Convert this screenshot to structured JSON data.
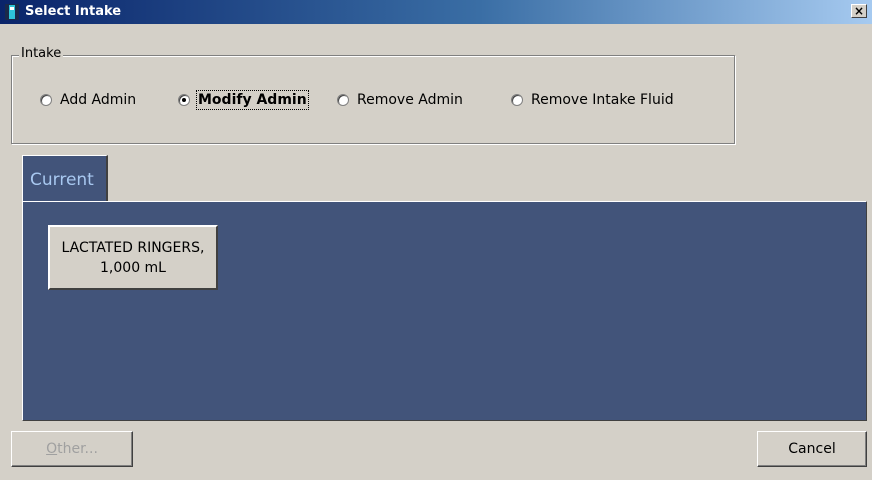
{
  "window": {
    "title": "Select Intake",
    "close_glyph": "×",
    "icon": "application-icon"
  },
  "intake_group": {
    "legend": "Intake",
    "options": [
      {
        "label": "Add Admin",
        "selected": false
      },
      {
        "label": "Modify Admin",
        "selected": true
      },
      {
        "label": "Remove Admin",
        "selected": false
      },
      {
        "label": "Remove Intake Fluid",
        "selected": false
      }
    ]
  },
  "tabs": [
    {
      "label": "Current",
      "active": true
    }
  ],
  "items": [
    {
      "label": "LACTATED RINGERS, 1,000 mL"
    }
  ],
  "footer": {
    "other_label": "Other...",
    "other_enabled": false,
    "cancel_label": "Cancel"
  },
  "colors": {
    "panel_bg": "#42547a",
    "dialog_bg": "#d4d0c8",
    "tab_text": "#a8c8f0"
  }
}
